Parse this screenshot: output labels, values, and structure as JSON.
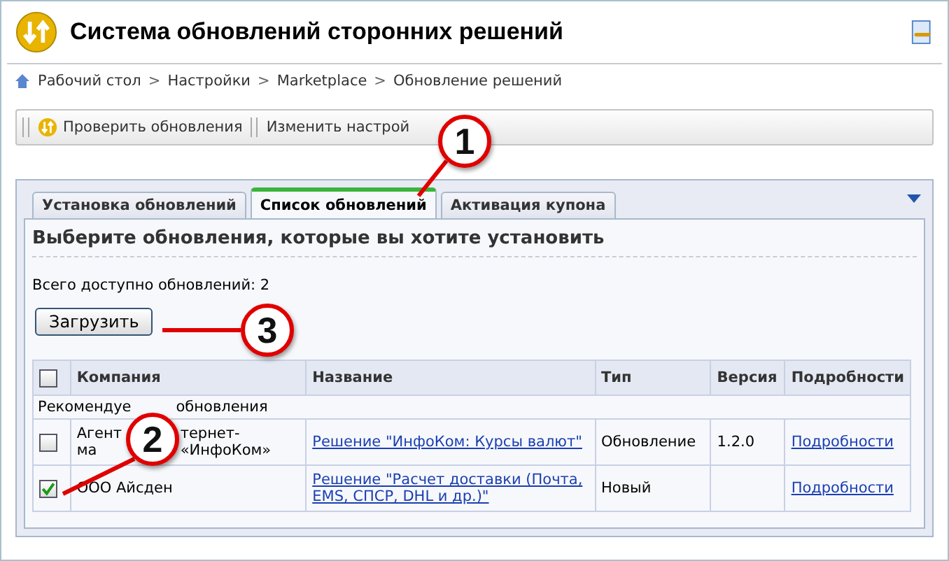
{
  "window": {
    "title": "Система обновлений сторонних решений"
  },
  "breadcrumb": [
    "Рабочий стол",
    "Настройки",
    "Marketplace",
    "Обновление решений"
  ],
  "breadcrumb_separator": ">",
  "toolbar": [
    {
      "label": "Проверить обновления",
      "kind": "icon"
    },
    {
      "label": "Изменить настрой",
      "kind": "plain"
    }
  ],
  "tabs": [
    {
      "label": "Установка обновлений",
      "selected": false
    },
    {
      "label": "Список обновлений",
      "selected": true
    },
    {
      "label": "Активация купона",
      "selected": false
    }
  ],
  "heading": "Выберите обновления, которые вы хотите установить",
  "total": "Всего доступно обновлений: 2",
  "load_button": "Загрузить",
  "table": {
    "select_all_checked": false,
    "columns": [
      "Компания",
      "Название",
      "Тип",
      "Версия",
      "Подробности"
    ],
    "group": [
      "Рекомендуе",
      "обновления"
    ],
    "rows": [
      {
        "checked": false,
        "company": [
          [
            "Агент",
            "тернет-"
          ],
          [
            "ма",
            "«ИнфоКом»"
          ]
        ],
        "name": "Решение \"ИнфоКом: Курсы валют\"",
        "type": "Обновление",
        "version": "1.2.0",
        "details": "Подробности"
      },
      {
        "checked": true,
        "company": [
          [
            "ООО Айсден"
          ]
        ],
        "name": "Решение \"Расчет доставки (Почта, EMS, СПСР, DHL и др.)\"",
        "type": "Новый",
        "details": "Подробности"
      }
    ]
  },
  "callouts": [
    "1",
    "2",
    "3"
  ]
}
